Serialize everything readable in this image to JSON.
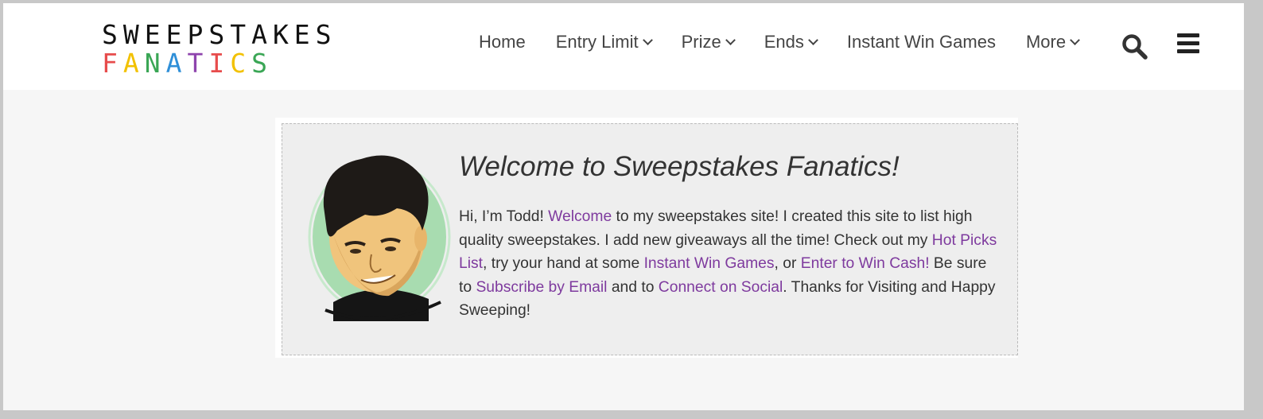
{
  "logo": {
    "line1": "SWEEPSTAKES",
    "line2_letters": [
      {
        "ch": "F",
        "color": "#e74c4c"
      },
      {
        "ch": "A",
        "color": "#f2c100"
      },
      {
        "ch": "N",
        "color": "#3aa655"
      },
      {
        "ch": "A",
        "color": "#2f8fd8"
      },
      {
        "ch": "T",
        "color": "#8e44ad"
      },
      {
        "ch": "I",
        "color": "#e74c4c"
      },
      {
        "ch": "C",
        "color": "#f2c100"
      },
      {
        "ch": "S",
        "color": "#3aa655"
      }
    ]
  },
  "nav": {
    "items": [
      {
        "label": "Home",
        "dropdown": false
      },
      {
        "label": "Entry Limit",
        "dropdown": true
      },
      {
        "label": "Prize",
        "dropdown": true
      },
      {
        "label": "Ends",
        "dropdown": true
      },
      {
        "label": "Instant Win Games",
        "dropdown": false
      },
      {
        "label": "More",
        "dropdown": true
      }
    ],
    "search_icon": "search-icon",
    "menu_icon": "hamburger-menu-icon"
  },
  "welcome": {
    "title": "Welcome to Sweepstakes Fanatics!",
    "t1": "Hi, I’m Todd! ",
    "l1": "Welcome",
    "t2": " to my sweepstakes site! I created this site to list high quality sweepstakes. I add new giveaways all the time! Check out my ",
    "l2": "Hot Picks List",
    "t3": ", try your hand at some ",
    "l3": "Instant Win Games",
    "t4": ", or ",
    "l4": "Enter to Win Cash!",
    "t5": " Be sure to ",
    "l5": "Subscribe by Email",
    "t6": " and to ",
    "l6": "Connect on Social",
    "t7": ". Thanks for Visiting and Happy Sweeping!"
  },
  "colors": {
    "link": "#7e3a9e",
    "text": "#333333",
    "page_bg": "#f6f6f6",
    "box_bg": "#eeeeee"
  }
}
